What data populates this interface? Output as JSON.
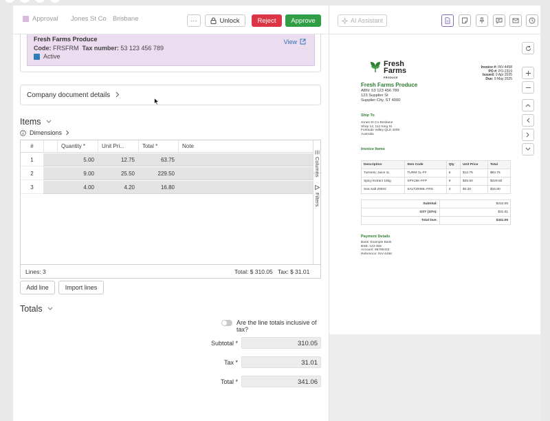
{
  "header": {
    "chips": [
      "Approval",
      "Jones St Co",
      "Brisbane"
    ],
    "more_label": "···",
    "unlock_label": "Unlock",
    "reject_label": "Reject",
    "approve_label": "Approve"
  },
  "supplier": {
    "name": "Fresh Farms Produce",
    "code_label": "Code:",
    "code": "FRSFRM",
    "tax_label": "Tax number:",
    "tax_number": "53 123 456 789",
    "status": "Active",
    "view_label": "View"
  },
  "company_doc_label": "Company document details",
  "items": {
    "title": "Items",
    "dimensions_label": "Dimensions",
    "columns": [
      "#",
      "Quantity *",
      "Unit Pri...",
      "Total *",
      "Note"
    ],
    "rows": [
      {
        "num": "1",
        "quantity": "5.00",
        "unit_price": "12.75",
        "total": "63.75",
        "note": ""
      },
      {
        "num": "2",
        "quantity": "9.00",
        "unit_price": "25.50",
        "total": "229.50",
        "note": ""
      },
      {
        "num": "3",
        "quantity": "4.00",
        "unit_price": "4.20",
        "total": "16.80",
        "note": ""
      }
    ],
    "side_columns": "Columns",
    "side_filters": "Filters",
    "lines_label": "Lines: 3",
    "total_label": "Total: $ 310.05",
    "tax_label": "Tax: $ 31.01",
    "add_line": "Add line",
    "import_lines": "Import lines"
  },
  "totals": {
    "title": "Totals",
    "inclusive_question": "Are the line totals inclusive of tax?",
    "subtotal_label": "Subtotal *",
    "subtotal": "310.05",
    "tax_label": "Tax *",
    "tax": "31.01",
    "total_label": "Total *",
    "total": "341.06"
  },
  "right": {
    "ai_label": "AI Assistant"
  },
  "invoice": {
    "logo_line1": "Fresh",
    "logo_line2": "Farms",
    "logo_line3": "PRODUCE",
    "meta": [
      {
        "label": "Invoice #:",
        "value": "INV-4498"
      },
      {
        "label": "PO #:",
        "value": "PO-2319"
      },
      {
        "label": "Issued:",
        "value": "9 Apr 2025"
      },
      {
        "label": "Due:",
        "value": "9 May 2025"
      }
    ],
    "company_name": "Fresh Farms Produce",
    "company_lines": [
      "ABN: 53 123 456 789",
      "123 Supplier St",
      "Supplier City, ST 4000"
    ],
    "ship_to_heading": "Ship To",
    "ship_to_lines": [
      "Jones St Co Brisbane",
      "Shop 12, 112 King St",
      "Fortitude Valley QLD 4006",
      "Australia"
    ],
    "items_heading": "Invoice Items",
    "item_columns": [
      "Description",
      "Item Code",
      "Qty",
      "Unit Price",
      "Total"
    ],
    "item_rows": [
      [
        "Turmeric Juice 1L",
        "TURM-1L-FF",
        "5",
        "$12.75",
        "$63.75"
      ],
      [
        "Spicy Extract 15kg",
        "SPX15K-FFP",
        "9",
        "$25.50",
        "$229.50"
      ],
      [
        "Sea Salt 200ml",
        "SALT200ML-FRS",
        "4",
        "$4.20",
        "$16.80"
      ]
    ],
    "totals_rows": [
      {
        "label": "Subtotal:",
        "value": "$310.05"
      },
      {
        "label": "GST (10%):",
        "value": "$31.01"
      },
      {
        "label": "Total Due:",
        "value": "$341.06"
      }
    ],
    "payment_heading": "Payment Details",
    "payment_lines": [
      "Bank: Example Bank",
      "BSB: 123-456",
      "Account: 98765432",
      "Reference: INV-4498"
    ]
  },
  "colors": {
    "reject": "#dc3545",
    "approve": "#2f9e44",
    "brand_green": "#2e7d32",
    "status_active": "#2d7fb8",
    "approval_chip": "#d9b8e2"
  }
}
